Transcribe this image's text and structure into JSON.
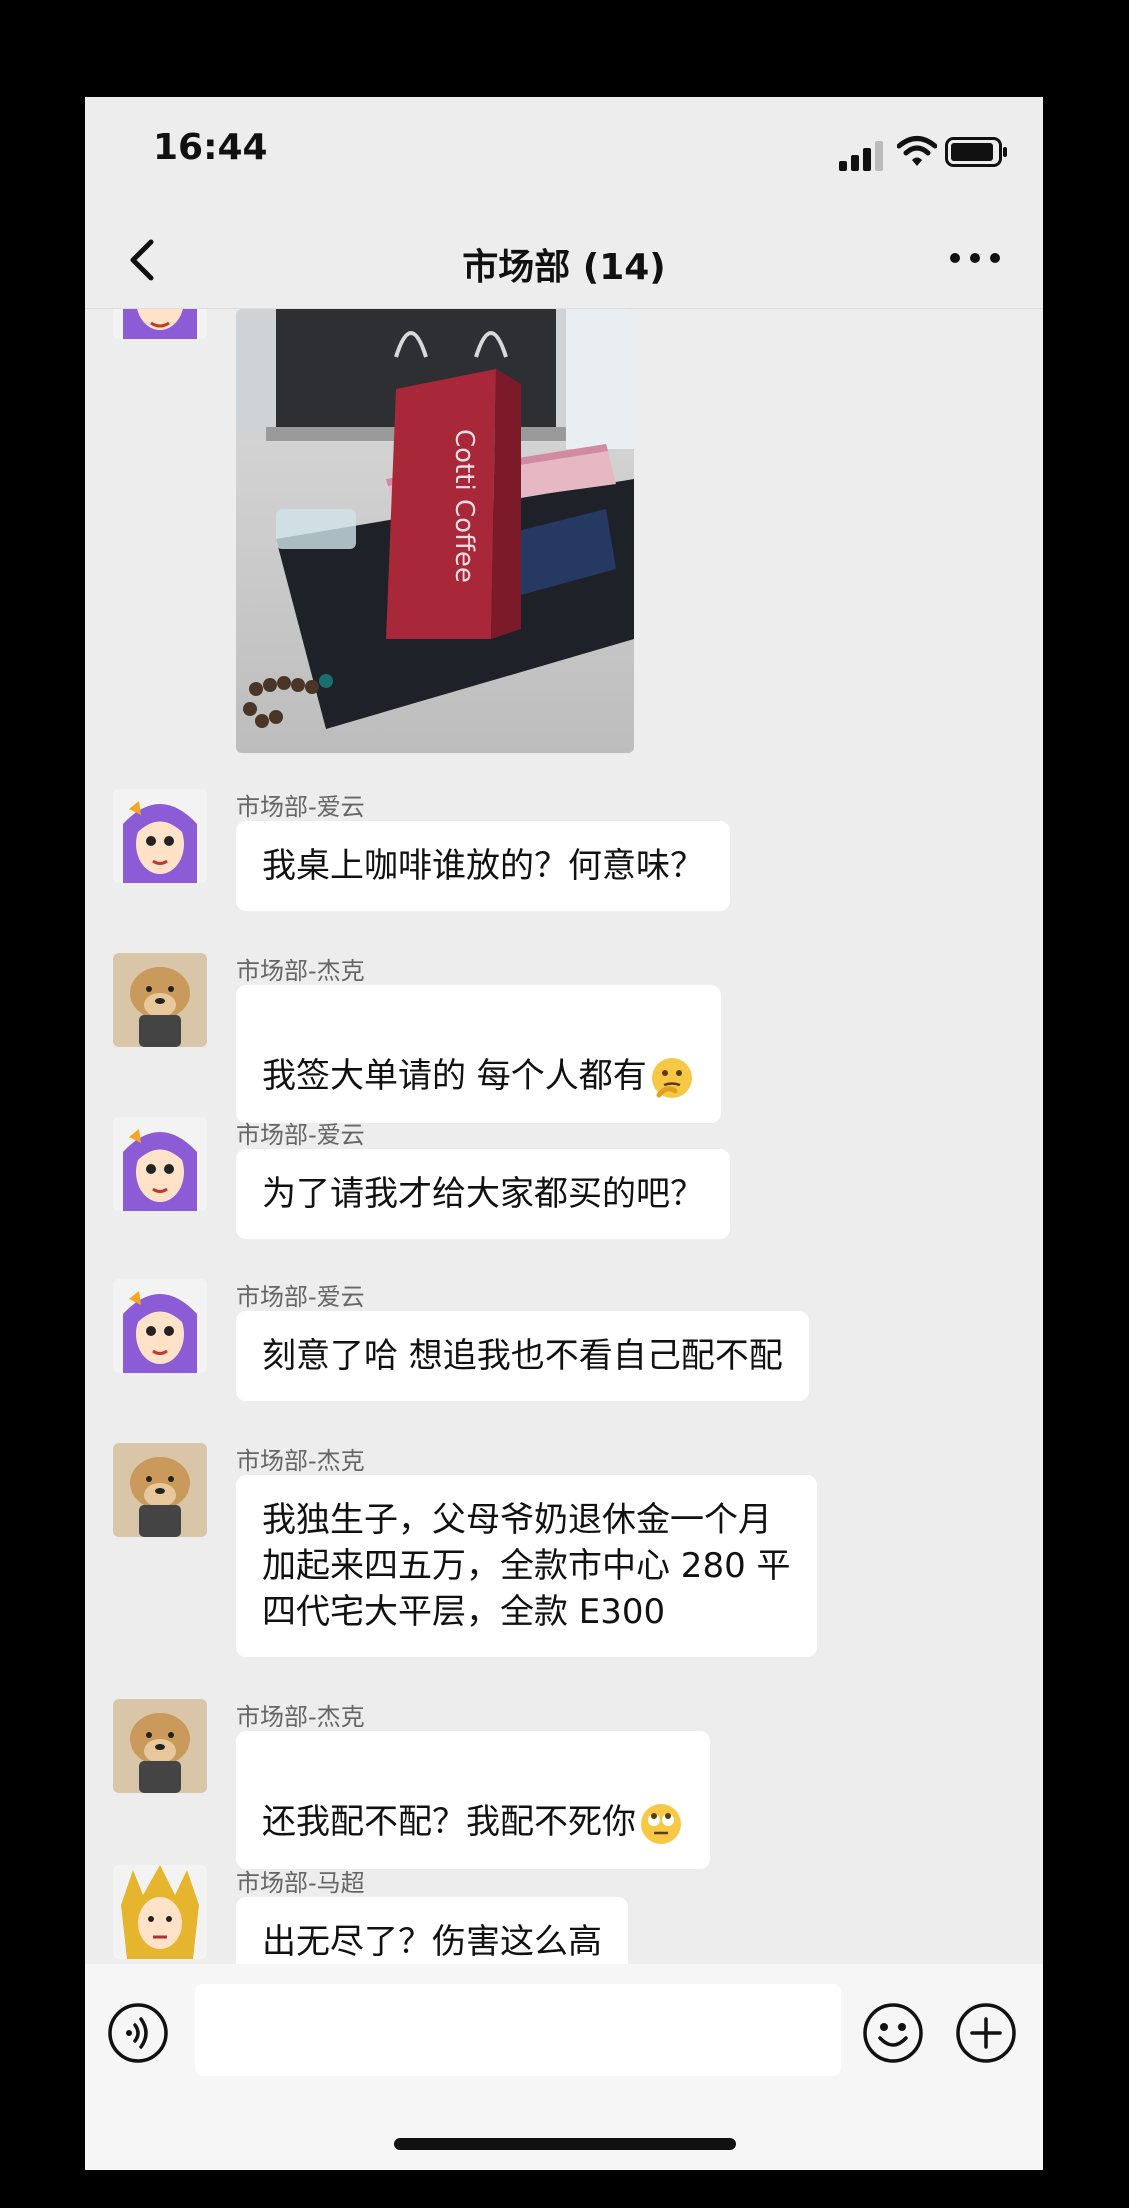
{
  "status_bar": {
    "time": "16:44"
  },
  "nav": {
    "title": "市场部 (14)"
  },
  "photo": {
    "bag_text": "Cotti Coffee"
  },
  "messages": [
    {
      "sender": "市场部-爱云",
      "text": "我桌上咖啡谁放的？何意味？",
      "avatar": "purple-hair-girl"
    },
    {
      "sender": "市场部-杰克",
      "text": "我签大单请的 每个人都有",
      "emoji": "thinking-face",
      "avatar": "dog"
    },
    {
      "sender": "市场部-爱云",
      "text": "为了请我才给大家都买的吧？",
      "avatar": "purple-hair-girl"
    },
    {
      "sender": "市场部-爱云",
      "text": "刻意了哈 想追我也不看自己配不配",
      "avatar": "purple-hair-girl"
    },
    {
      "sender": "市场部-杰克",
      "text": "我独生子，父母爷奶退休金一个月\n加起来四五万，全款市中心 280 平\n四代宅大平层，全款 E300",
      "avatar": "dog"
    },
    {
      "sender": "市场部-杰克",
      "text": "还我配不配？我配不死你",
      "emoji": "eye-roll-face",
      "avatar": "dog"
    },
    {
      "sender": "市场部-马超",
      "text": "出无尽了？伤害这么高",
      "avatar": "golden-warrior"
    }
  ],
  "colors": {
    "background": "#ededed",
    "bubble": "#ffffff",
    "sender_text": "#666666",
    "avatar_purple": "#8b5cd6"
  }
}
